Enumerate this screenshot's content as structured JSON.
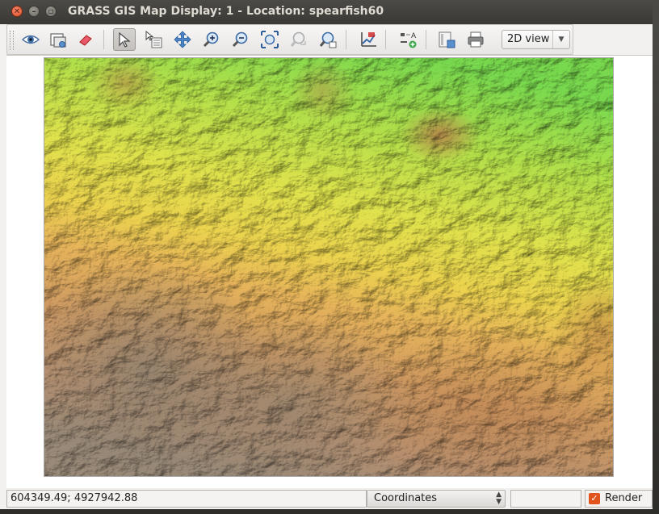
{
  "window": {
    "title": "GRASS GIS Map Display: 1  - Location: spearfish60",
    "close_glyph": "✕",
    "min_glyph": "–",
    "max_glyph": "▫"
  },
  "toolbar": {
    "buttons": [
      {
        "name": "display-map-button",
        "icon": "eye-icon"
      },
      {
        "name": "render-map-button",
        "icon": "render-icon"
      },
      {
        "name": "erase-button",
        "icon": "eraser-icon"
      },
      {
        "name": "pointer-button",
        "icon": "pointer-icon",
        "active": true
      },
      {
        "name": "query-button",
        "icon": "query-icon"
      },
      {
        "name": "pan-button",
        "icon": "pan-icon"
      },
      {
        "name": "zoom-in-button",
        "icon": "zoom-in-icon"
      },
      {
        "name": "zoom-out-button",
        "icon": "zoom-out-icon"
      },
      {
        "name": "zoom-extent-button",
        "icon": "zoom-extent-icon"
      },
      {
        "name": "zoom-back-button",
        "icon": "zoom-back-icon"
      },
      {
        "name": "zoom-menu-button",
        "icon": "zoom-menu-icon"
      },
      {
        "name": "analyze-button",
        "icon": "analyze-icon"
      },
      {
        "name": "overlay-button",
        "icon": "overlay-icon"
      },
      {
        "name": "save-button",
        "icon": "save-icon"
      },
      {
        "name": "print-button",
        "icon": "print-icon"
      }
    ],
    "view_select": {
      "value": "2D view",
      "arrow": "▼"
    }
  },
  "statusbar": {
    "coordinates": "604349.49; 4927942.88",
    "mode": "Coordinates",
    "mode_arrows": "▲▼",
    "render_label": "Render",
    "render_checked": true,
    "render_check_glyph": "✓"
  },
  "colors": {
    "accent": "#e2541e",
    "titlebar": "#3c3b37",
    "map_low": "#6fd54a",
    "map_mid": "#e8d248",
    "map_high": "#c8823c"
  }
}
